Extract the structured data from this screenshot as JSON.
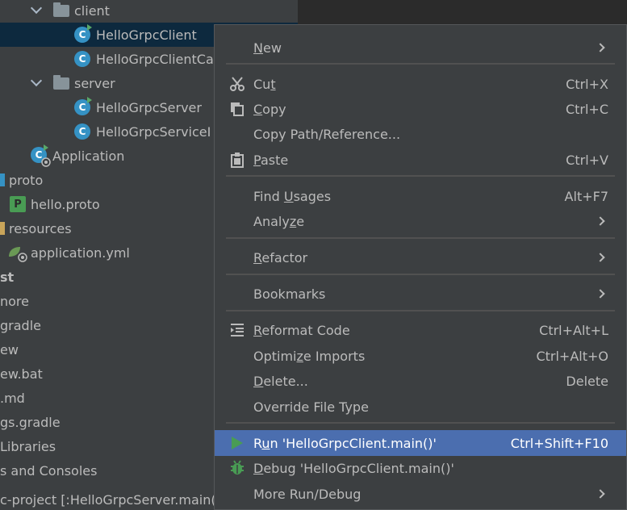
{
  "tree": {
    "items": [
      {
        "label": "client",
        "type": "folder"
      },
      {
        "label": "HelloGrpcClient",
        "type": "class-run",
        "selected": true
      },
      {
        "label": "HelloGrpcClientCa",
        "type": "class"
      },
      {
        "label": "server",
        "type": "folder"
      },
      {
        "label": "HelloGrpcServer",
        "type": "class-run"
      },
      {
        "label": "HelloGrpcServiceI",
        "type": "class"
      },
      {
        "label": "Application",
        "type": "spring-app"
      },
      {
        "label": "proto",
        "type": "source-folder"
      },
      {
        "label": "hello.proto",
        "type": "proto-file"
      },
      {
        "label": "resources",
        "type": "resources-folder"
      },
      {
        "label": "application.yml",
        "type": "yml-file"
      },
      {
        "label": "st",
        "type": "folder-bold"
      },
      {
        "label": "nore",
        "type": "file"
      },
      {
        "label": "gradle",
        "type": "file"
      },
      {
        "label": "ew",
        "type": "file"
      },
      {
        "label": "ew.bat",
        "type": "file"
      },
      {
        "label": ".md",
        "type": "file"
      },
      {
        "label": "gs.gradle",
        "type": "file"
      },
      {
        "label": "Libraries",
        "type": "file"
      },
      {
        "label": "s and Consoles",
        "type": "file"
      },
      {
        "label": "c-project [:HelloGrpcServer.main(",
        "type": "status"
      }
    ]
  },
  "menu": {
    "new": {
      "label_pre": "",
      "label_u": "N",
      "label_post": "ew"
    },
    "cut": {
      "label_pre": "Cu",
      "label_u": "t",
      "label_post": "",
      "key": "Ctrl+X"
    },
    "copy": {
      "label_pre": "",
      "label_u": "C",
      "label_post": "opy",
      "key": "Ctrl+C"
    },
    "copy_path": {
      "label": "Copy Path/Reference..."
    },
    "paste": {
      "label_pre": "",
      "label_u": "P",
      "label_post": "aste",
      "key": "Ctrl+V"
    },
    "find_usages": {
      "label_pre": "Find ",
      "label_u": "U",
      "label_post": "sages",
      "key": "Alt+F7"
    },
    "analyze": {
      "label_pre": "Analy",
      "label_u": "z",
      "label_post": "e"
    },
    "refactor": {
      "label_pre": "",
      "label_u": "R",
      "label_post": "efactor"
    },
    "bookmarks": {
      "label": "Bookmarks"
    },
    "reformat": {
      "label_pre": "",
      "label_u": "R",
      "label_post": "eformat Code",
      "key": "Ctrl+Alt+L"
    },
    "optimize": {
      "label_pre": "Optimi",
      "label_u": "z",
      "label_post": "e Imports",
      "key": "Ctrl+Alt+O"
    },
    "delete": {
      "label_pre": "",
      "label_u": "D",
      "label_post": "elete...",
      "key": "Delete"
    },
    "override": {
      "label": "Override File Type"
    },
    "run": {
      "label_pre": "R",
      "label_u": "u",
      "label_post": "n 'HelloGrpcClient.main()'",
      "key": "Ctrl+Shift+F10"
    },
    "debug": {
      "label_pre": "",
      "label_u": "D",
      "label_post": "ebug 'HelloGrpcClient.main()'"
    },
    "more_run": {
      "label": "More Run/Debug"
    }
  },
  "colors": {
    "menu_bg": "#3c3f41",
    "selection": "#4b6eaf",
    "tree_selection": "#0d293e",
    "run_green": "#499c54"
  }
}
